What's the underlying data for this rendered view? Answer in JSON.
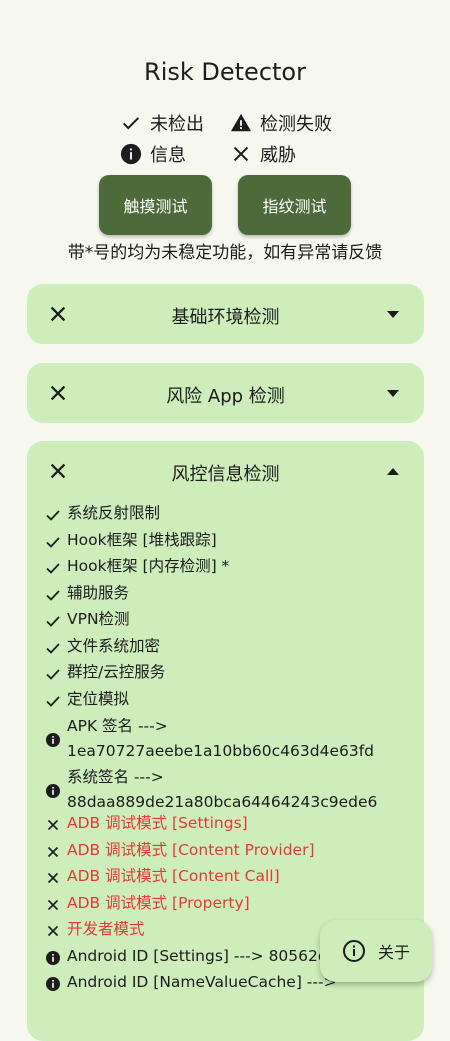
{
  "app": {
    "title": "Risk Detector"
  },
  "legend": {
    "not_detected": "未检出",
    "detect_failed": "检测失败",
    "info": "信息",
    "threat": "威胁"
  },
  "buttons": {
    "touch_test": "触摸测试",
    "fingerprint_test": "指纹测试"
  },
  "note": "带*号的均为未稳定功能，如有异常请反馈",
  "cards": [
    {
      "title": "基础环境检测",
      "status_icon": "close-icon",
      "expanded": false
    },
    {
      "title": "风险 App 检测",
      "status_icon": "close-icon",
      "expanded": false
    },
    {
      "title": "风控信息检测",
      "status_icon": "close-icon",
      "expanded": true
    }
  ],
  "risk_items": [
    {
      "icon": "check-icon",
      "text": "系统反射限制",
      "color": "#1c1c1c"
    },
    {
      "icon": "check-icon",
      "text": "Hook框架 [堆栈跟踪]",
      "color": "#1c1c1c"
    },
    {
      "icon": "check-icon",
      "text": "Hook框架 [内存检测] *",
      "color": "#1c1c1c"
    },
    {
      "icon": "check-icon",
      "text": "辅助服务",
      "color": "#1c1c1c"
    },
    {
      "icon": "check-icon",
      "text": "VPN检测",
      "color": "#1c1c1c"
    },
    {
      "icon": "check-icon",
      "text": "文件系统加密",
      "color": "#1c1c1c"
    },
    {
      "icon": "check-icon",
      "text": "群控/云控服务",
      "color": "#1c1c1c"
    },
    {
      "icon": "check-icon",
      "text": "定位模拟",
      "color": "#1c1c1c"
    },
    {
      "icon": "info-icon",
      "text": "APK 签名 --->\n1ea70727aeebe1a10bb60c463d4e63fd",
      "color": "#1c1c1c"
    },
    {
      "icon": "info-icon",
      "text": "系统签名 --->\n88daa889de21a80bca64464243c9ede6",
      "color": "#1c1c1c"
    },
    {
      "icon": "threat-icon",
      "text": "ADB 调试模式 [Settings]",
      "color": "#e53935"
    },
    {
      "icon": "threat-icon",
      "text": "ADB 调试模式 [Content Provider]",
      "color": "#e53935"
    },
    {
      "icon": "threat-icon",
      "text": "ADB 调试模式 [Content Call]",
      "color": "#e53935"
    },
    {
      "icon": "threat-icon",
      "text": "ADB 调试模式 [Property]",
      "color": "#e53935"
    },
    {
      "icon": "threat-icon",
      "text": "开发者模式",
      "color": "#e53935"
    },
    {
      "icon": "info-icon",
      "text": "Android ID [Settings] ---> 80562d5",
      "color": "#1c1c1c"
    },
    {
      "icon": "info-icon",
      "text": "Android ID [NameValueCache] --->",
      "color": "#1c1c1c"
    }
  ],
  "fab": {
    "label": "关于",
    "icon": "info-outline-icon"
  }
}
